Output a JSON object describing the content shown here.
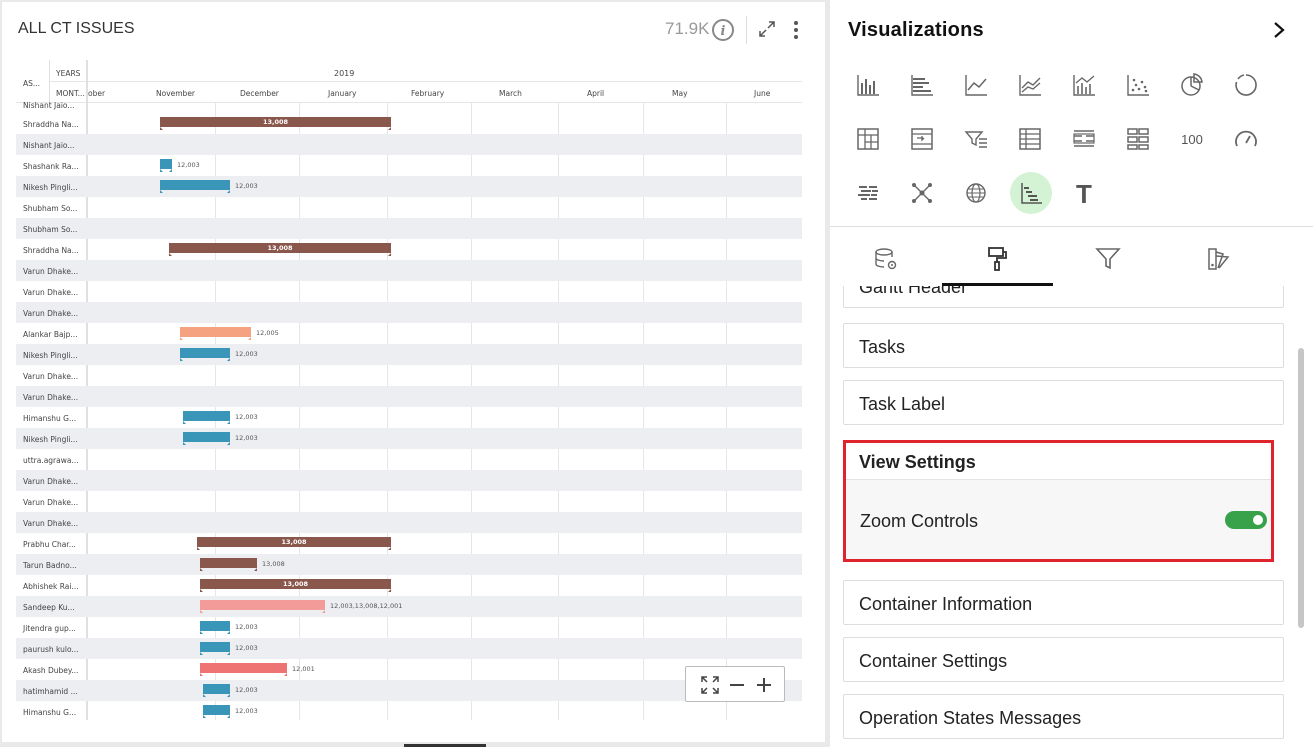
{
  "left_panel": {
    "title": "ALL CT ISSUES",
    "count": "71.9K"
  },
  "gantt": {
    "col_header_as": "AS...",
    "col_header_years": "YEARS",
    "col_header_months": "MONT...",
    "year": "2019",
    "months": [
      "ober",
      "November",
      "December",
      "January",
      "February",
      "March",
      "April",
      "May",
      "June"
    ],
    "top_partial_row": "Nishant Jaio...",
    "rows": [
      {
        "name": "Shraddha Na...",
        "bar": {
          "start": 158,
          "end": 389,
          "color": "#8a574d",
          "label": "13,008",
          "inside": true
        }
      },
      {
        "name": "Nishant Jaio...",
        "bar": null
      },
      {
        "name": "Shashank Ra...",
        "bar": {
          "start": 158,
          "end": 170,
          "color": "#3a96b8",
          "label": "12,003",
          "inside": false
        }
      },
      {
        "name": "Nikesh Pingli...",
        "bar": {
          "start": 158,
          "end": 228,
          "color": "#3a96b8",
          "label": "12,003",
          "inside": false
        }
      },
      {
        "name": "Shubham So...",
        "bar": null
      },
      {
        "name": "Shubham So...",
        "bar": null
      },
      {
        "name": "Shraddha Na...",
        "bar": {
          "start": 167,
          "end": 389,
          "color": "#8a574d",
          "label": "13,008",
          "inside": true
        }
      },
      {
        "name": "Varun Dhake...",
        "bar": null
      },
      {
        "name": "Varun Dhake...",
        "bar": null
      },
      {
        "name": "Varun Dhake...",
        "bar": null
      },
      {
        "name": "Alankar Bajp...",
        "bar": {
          "start": 178,
          "end": 249,
          "color": "#f4a27f",
          "label": "12,005",
          "inside": false
        }
      },
      {
        "name": "Nikesh Pingli...",
        "bar": {
          "start": 178,
          "end": 228,
          "color": "#3a96b8",
          "label": "12,003",
          "inside": false
        }
      },
      {
        "name": "Varun Dhake...",
        "bar": null
      },
      {
        "name": "Varun Dhake...",
        "bar": null
      },
      {
        "name": "Himanshu G...",
        "bar": {
          "start": 181,
          "end": 228,
          "color": "#3a96b8",
          "label": "12,003",
          "inside": false
        }
      },
      {
        "name": "Nikesh Pingli...",
        "bar": {
          "start": 181,
          "end": 228,
          "color": "#3a96b8",
          "label": "12,003",
          "inside": false
        }
      },
      {
        "name": "uttra.agrawa...",
        "bar": null
      },
      {
        "name": "Varun Dhake...",
        "bar": null
      },
      {
        "name": "Varun Dhake...",
        "bar": null
      },
      {
        "name": "Varun Dhake...",
        "bar": null
      },
      {
        "name": "Prabhu Char...",
        "bar": {
          "start": 195,
          "end": 389,
          "color": "#8a574d",
          "label": "13,008",
          "inside": true
        }
      },
      {
        "name": "Tarun Badno...",
        "bar": {
          "start": 198,
          "end": 255,
          "color": "#8a574d",
          "label": "13,008",
          "inside": false
        }
      },
      {
        "name": "Abhishek Rai...",
        "bar": {
          "start": 198,
          "end": 389,
          "color": "#8a574d",
          "label": "13,008",
          "inside": true
        }
      },
      {
        "name": "Sandeep Ku...",
        "bar": {
          "start": 198,
          "end": 323,
          "color": "#f29b98",
          "label": "12,003,13,008,12,001",
          "inside": false
        }
      },
      {
        "name": "Jitendra gup...",
        "bar": {
          "start": 198,
          "end": 228,
          "color": "#3a96b8",
          "label": "12,003",
          "inside": false
        }
      },
      {
        "name": "paurush kulo...",
        "bar": {
          "start": 198,
          "end": 228,
          "color": "#3a96b8",
          "label": "12,003",
          "inside": false
        }
      },
      {
        "name": "Akash Dubey...",
        "bar": {
          "start": 198,
          "end": 285,
          "color": "#ee7474",
          "label": "12,001",
          "inside": false
        }
      },
      {
        "name": "hatimhamid ...",
        "bar": {
          "start": 201,
          "end": 228,
          "color": "#3a96b8",
          "label": "12,003",
          "inside": false
        }
      },
      {
        "name": "Himanshu G...",
        "bar": {
          "start": 201,
          "end": 228,
          "color": "#3a96b8",
          "label": "12,003",
          "inside": false
        }
      }
    ]
  },
  "zoom_controls": {
    "icons": [
      "fit-screen-icon",
      "minus-icon",
      "plus-icon"
    ]
  },
  "right_panel": {
    "title": "Visualizations",
    "viz_icons": [
      [
        "bar-chart-icon",
        "horizontal-bar-icon",
        "line-chart-icon",
        "area-line-icon",
        "combo-chart-icon",
        "scatter-icon",
        "pie-chart-icon",
        "donut-icon"
      ],
      [
        "pivot-table-icon",
        "drilldown-table-icon",
        "filter-list-icon",
        "grid-table-icon",
        "list-table-icon",
        "tiles-icon",
        "kpi-number-icon",
        "gauge-icon"
      ],
      [
        "heatmap-icon",
        "network-icon",
        "globe-icon",
        "gantt-icon",
        "text-icon"
      ]
    ],
    "kpi_text": "100",
    "text_icon_glyph": "T",
    "tabs": [
      "data-source-tab",
      "format-tab",
      "filter-tab",
      "style-tab"
    ],
    "sections": {
      "gantt_header": "Gantt Header",
      "tasks": "Tasks",
      "task_label": "Task Label",
      "view_settings": "View Settings",
      "zoom_controls": "Zoom Controls",
      "zoom_controls_on": true,
      "container_information": "Container Information",
      "container_settings": "Container Settings",
      "operation_states_messages": "Operation States Messages"
    },
    "accent_color": "#37a24a",
    "highlight_color": "#e0242e"
  }
}
